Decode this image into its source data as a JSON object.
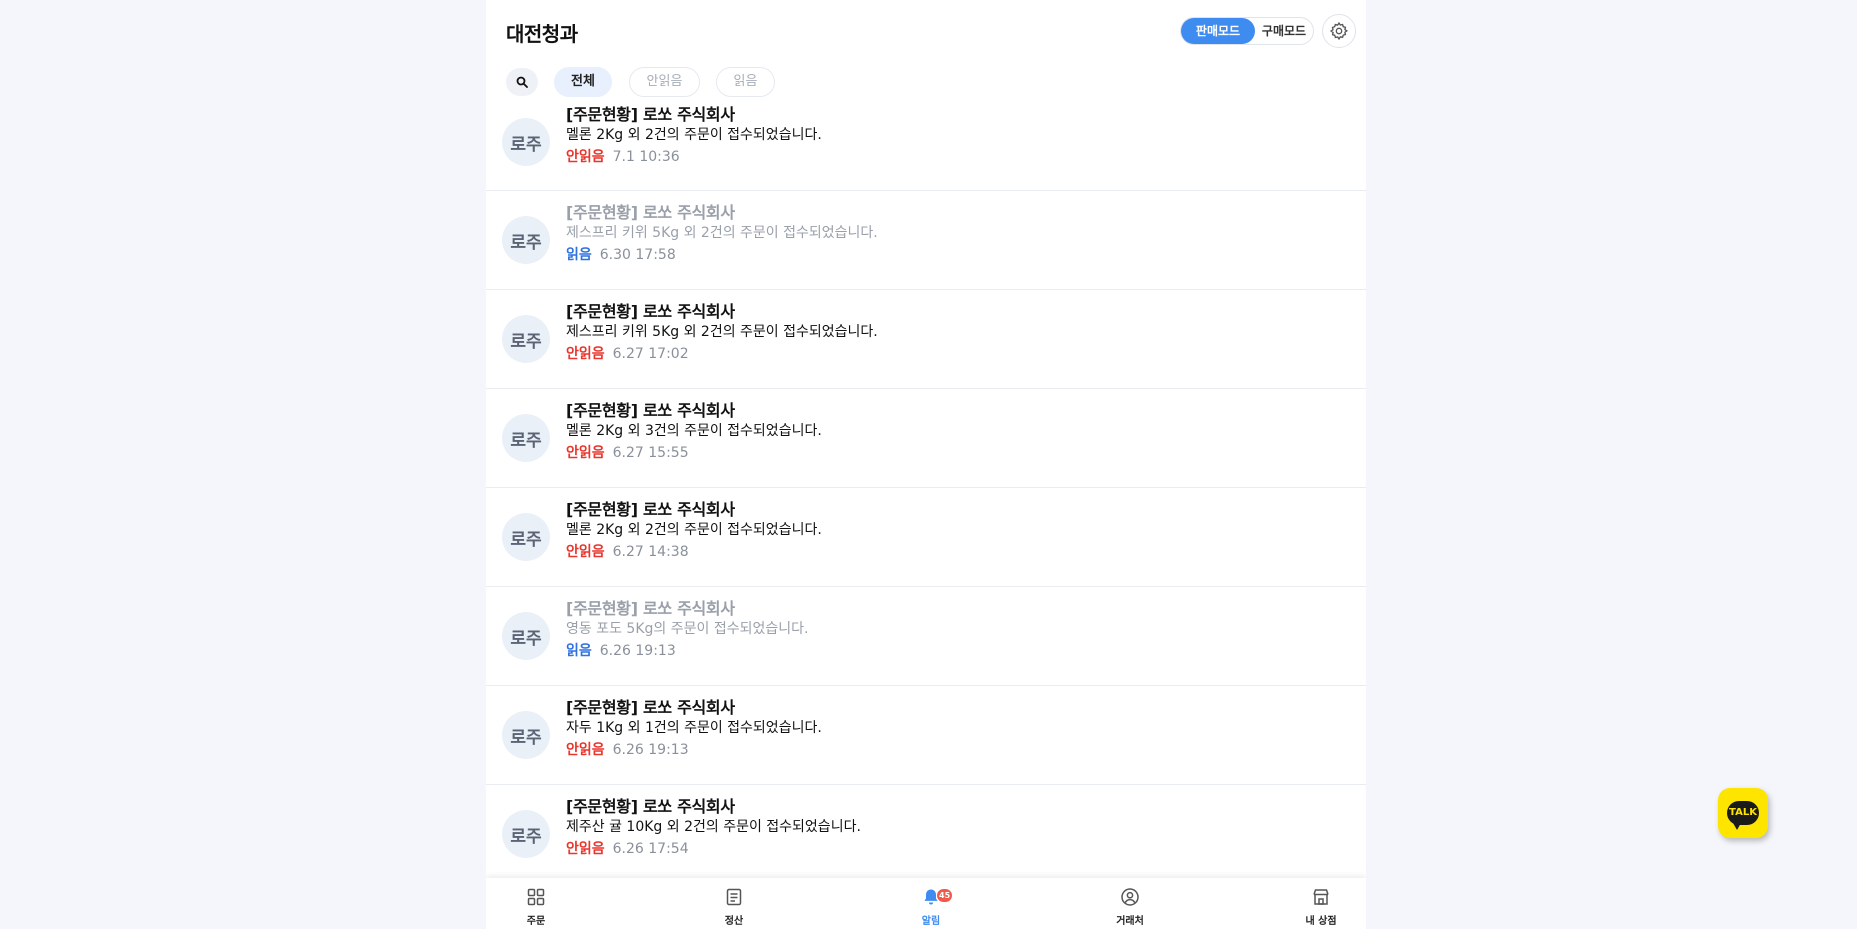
{
  "header": {
    "title": "대전청과",
    "mode_sell_label": "판매모드",
    "mode_buy_label": "구매모드"
  },
  "filters": {
    "all_label": "전체",
    "unread_label": "안읽음",
    "read_label": "읽음"
  },
  "notifications": [
    {
      "avatar": "로주",
      "title": "[주문현황] 로쏘 주식회사",
      "body": "멜론 2Kg 외 2건의 주문이 접수되었습니다.",
      "status": "안읽음",
      "read": false,
      "time": "7.1 10:36"
    },
    {
      "avatar": "로주",
      "title": "[주문현황] 로쏘 주식회사",
      "body": "제스프리 키위 5Kg 외 2건의 주문이 접수되었습니다.",
      "status": "읽음",
      "read": true,
      "time": "6.30 17:58"
    },
    {
      "avatar": "로주",
      "title": "[주문현황] 로쏘 주식회사",
      "body": "제스프리 키위 5Kg 외 2건의 주문이 접수되었습니다.",
      "status": "안읽음",
      "read": false,
      "time": "6.27 17:02"
    },
    {
      "avatar": "로주",
      "title": "[주문현황] 로쏘 주식회사",
      "body": "멜론 2Kg 외 3건의 주문이 접수되었습니다.",
      "status": "안읽음",
      "read": false,
      "time": "6.27 15:55"
    },
    {
      "avatar": "로주",
      "title": "[주문현황] 로쏘 주식회사",
      "body": "멜론 2Kg 외 2건의 주문이 접수되었습니다.",
      "status": "안읽음",
      "read": false,
      "time": "6.27 14:38"
    },
    {
      "avatar": "로주",
      "title": "[주문현황] 로쏘 주식회사",
      "body": "영동 포도 5Kg의 주문이 접수되었습니다.",
      "status": "읽음",
      "read": true,
      "time": "6.26 19:13"
    },
    {
      "avatar": "로주",
      "title": "[주문현황] 로쏘 주식회사",
      "body": "자두 1Kg 외 1건의 주문이 접수되었습니다.",
      "status": "안읽음",
      "read": false,
      "time": "6.26 19:13"
    },
    {
      "avatar": "로주",
      "title": "[주문현황] 로쏘 주식회사",
      "body": "제주산 귤 10Kg 외 2건의 주문이 접수되었습니다.",
      "status": "안읽음",
      "read": false,
      "time": "6.26 17:54"
    }
  ],
  "tabbar": {
    "orders_label": "주문",
    "settlement_label": "정산",
    "alerts_label": "알림",
    "alerts_badge": "45",
    "partners_label": "거래처",
    "mystore_label": "내 상점"
  },
  "talk_button": {
    "label": "TALK"
  },
  "colors": {
    "accent": "#3f8cf0",
    "unread": "#e8362d",
    "read": "#2f72e0",
    "talk": "#fee500"
  },
  "icons": {
    "settings": "gear-icon",
    "search": "search-icon",
    "orders": "grid-icon",
    "settlement": "document-icon",
    "alerts": "bell-icon",
    "partners": "person-circle-icon",
    "mystore": "store-icon"
  }
}
